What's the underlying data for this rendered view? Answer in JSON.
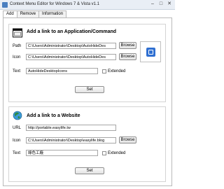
{
  "window": {
    "title": "Context Menu Editor for Windows 7 & Vista v1.1",
    "buttons": [
      "–",
      "□",
      "✕"
    ]
  },
  "tabs": [
    "Add",
    "Remove",
    "Information"
  ],
  "app_section": {
    "title": "Add a link to an Application/Command",
    "path_label": "Path",
    "path_value": "C:\\Users\\Administrator\\Desktop\\AutoHideDes",
    "icon_label": "Icon",
    "icon_value": "C:\\Users\\Administrator\\Desktop\\AutoHideDes",
    "text_label": "Text",
    "text_value": "AutoHideDesktopIcons",
    "extended_label": "Extended",
    "browse": "Browse",
    "set": "Set"
  },
  "web_section": {
    "title": "Add a link to a Website",
    "url_label": "URL",
    "url_value": "http://portable.easylife.tw",
    "icon_label": "Icon",
    "icon_value": "C:\\Users\\Administrator\\Desktop\\easylife.blog",
    "text_label": "Text",
    "text_value": "綠色工廠",
    "extended_label": "Extended",
    "browse": "Browse",
    "set": "Set"
  },
  "icons": {
    "app": "app-window-icon",
    "section1": "application-window-icon",
    "section2": "globe-icon",
    "info": "info-icon",
    "preview": "preview-app-icon"
  },
  "colors": {
    "globe": "#2f8a43",
    "preview_icon": "#2f6fd1"
  }
}
